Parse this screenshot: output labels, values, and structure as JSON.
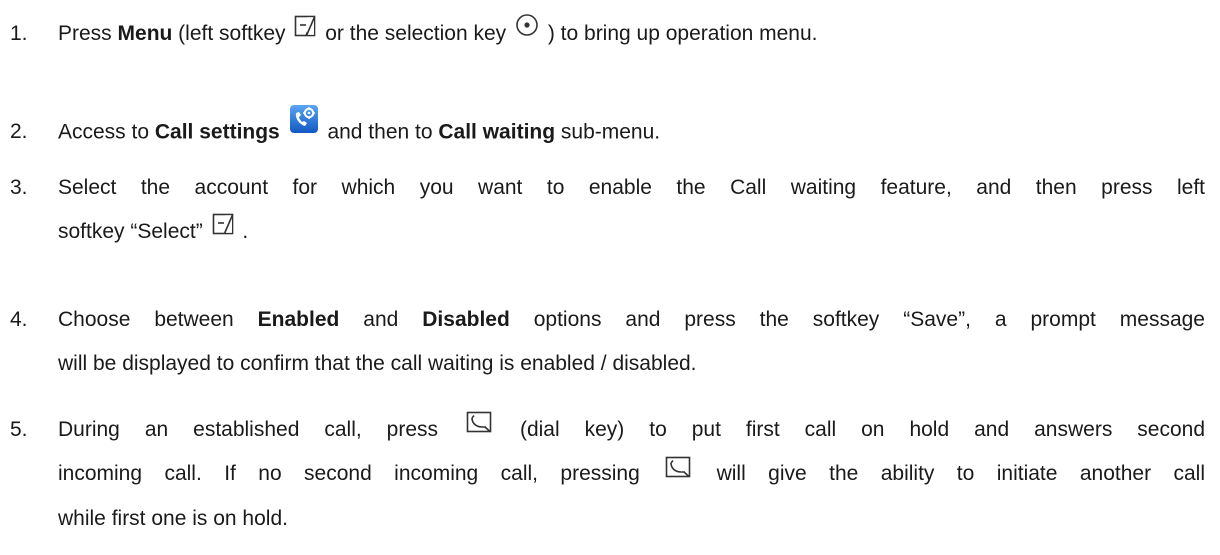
{
  "steps": [
    {
      "num": "1.",
      "t1": "Press ",
      "b1": "Menu",
      "t2": " (left softkey ",
      "t3": " or the selection key ",
      "t4": " ) to bring up operation menu."
    },
    {
      "num": "2.",
      "t1": "Access to ",
      "b1": "Call settings",
      "t2": " and then to ",
      "b2": "Call waiting",
      "t3": " sub-menu."
    },
    {
      "num": "3.",
      "t1": "Select the account for which you want to enable the Call waiting feature, and then press left",
      "t2": "softkey “Select” ",
      "t3": " ."
    },
    {
      "num": "4.",
      "t1": "Choose between ",
      "b1": "Enabled",
      "t2": " and ",
      "b2": "Disabled",
      "t3": " options and press the softkey “Save”, a prompt message",
      "t4": "will be displayed to confirm that the call waiting is enabled / disabled."
    },
    {
      "num": "5.",
      "t1": "During an established call, press ",
      "t2": " (dial key) to put first call on hold and answers second",
      "t3": "incoming call. If no second incoming call, pressing ",
      "t4": " will give the ability to initiate another call",
      "t5": "while first one is on hold."
    }
  ],
  "icons": {
    "left_softkey": "left-softkey-icon",
    "selection_key": "selection-key-icon",
    "call_settings": "call-settings-icon",
    "dial_key": "dial-key-icon"
  },
  "colors": {
    "text": "#1a1a1a",
    "icon_stroke": "#333333",
    "call_settings_blue": "#1e6fd9"
  }
}
